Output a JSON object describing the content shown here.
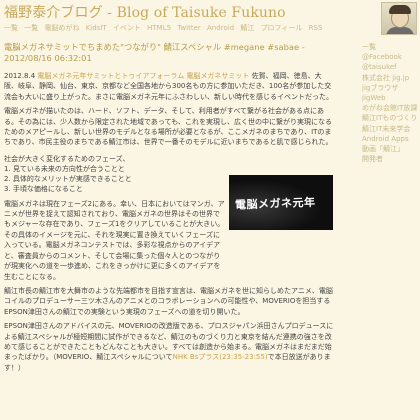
{
  "header": {
    "site_title": "福野泰介ブログ - Blog of Taisuke Fukuno",
    "nav": [
      "一覧",
      "一覧",
      "電脳めがね",
      "KidsIT",
      "イベント",
      "HTML5",
      "Twitter",
      "Android",
      "鯖江",
      "プロフィール",
      "RSS"
    ]
  },
  "post": {
    "title": "電脳メガネサミットでちまめた\"つながり\" 鯖江スペシャル #megane #sabae - 2012/08/16 06:32:01",
    "intro_date": "2012.8.4",
    "intro_link": "電脳メガネ元年",
    "intro_text_a": "サミットとトゥイアフォーラム",
    "intro_text_b": "電脳メガネサミット",
    "intro_text_c": "佐賀、福岡、徳島、大阪、岐阜、静岡、仙台、東京、京都など全国各地から300名もの方に参加いただき、100名が参加した交流会も大いに盛り上がった。まさに電脳メガネ元年にふさわしい、新しい時代を感じるイベントだった。",
    "para2": "電脳メガネが描いたのは、ハード、ソフト、データ、そして、利用者がすべて繋がる社会がある点にある。その為には、少人数から限定された地域であっても、これを実現し、広く世の中に繋がり実現になるためのメアピールし、新しい世界のモデルとなる場所が必要となるが、ここメガネのまちであり、ITのまちであり、市民主役のまちである鯖江市は、世界で一番そのモデルに近いまちであると肌で感じられた。",
    "list_heading": "社会が大きく変化するためのフェーズ、",
    "list": [
      "1. 見ている未来の方向性が合うことと",
      "2. 具体的なメリットが実感できることと",
      "3. 手頃な価格になること"
    ],
    "para4": "電脳メガネは現在フェーズ2にある。幸い、日本においてはマンガ、アニメが世界を捉えて認知されており、電脳メガネの世界はその世界でもメジャーな存在であり、フェーズ1をクリアしていることが大きい。その具体のイメージを元に、それを現実に置き換えていくフェーズに入っている。電脳メガネコンテストでは、多彩な視点からのアイデアと、審査員からのコメント、そして会場に集った個々人とのつながりが現実化への道を一歩進め、これをきっかけに更に多くのアイデアを生むことになる。",
    "para5": "鯖江市長の鯖江市を大舞市のような先端都市を目指す宣言は、電脳メガネを世に知らしめたアニメ、電脳コイルのプロデューサー三ツ木さんのアニメとのコラボレーションへの可能性や、MOVERIOを担当するEPSON津田さんの鯖江での実験という実現のフェーズへの道を切り開いた。",
    "para6": "EPSON津田さんのアドバイスの元、MOVERIOの改造版である、プロスジャパン浜田さんプロデュースによる鯖江スペシャルが極短期間に試作ができるなど、鯖江のものづくり力と東京を結んだ連携の強さを改めて感じることができたこともどんなことも大きい。すべては創造から始まる。電脳メガネはまだまだ始まったばかり。（MOVERIO、鯖江スペシャルについて",
    "para6_link": "NHK Bsプラス(23:35-23:55)",
    "para6_end": "で本日放送があります！）"
  },
  "photo": {
    "caption": "電脳メガネ元年"
  },
  "sidebar": {
    "items": [
      "一覧",
      "@Facebook",
      "@taisukef",
      "株式会社 jig.jp",
      "jigブラウザ",
      "jigWeb",
      "めがね会館IT放課後",
      "鯖江ITものづくり",
      "鯖江IT未来学会",
      "Android Apps",
      "動画「鯖江」",
      "開発者"
    ]
  }
}
